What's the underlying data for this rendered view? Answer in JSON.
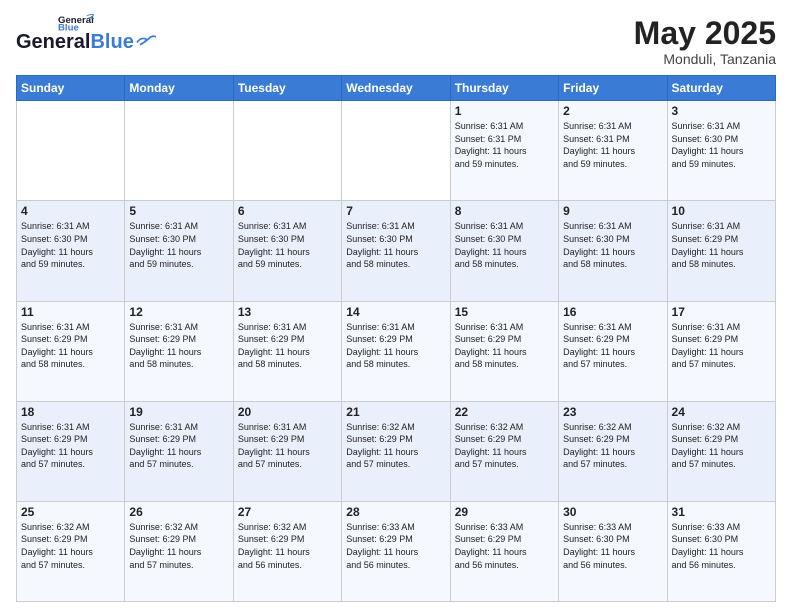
{
  "header": {
    "logo_line1": "General",
    "logo_line2": "Blue",
    "month_year": "May 2025",
    "location": "Monduli, Tanzania"
  },
  "days_of_week": [
    "Sunday",
    "Monday",
    "Tuesday",
    "Wednesday",
    "Thursday",
    "Friday",
    "Saturday"
  ],
  "weeks": [
    [
      {
        "day": "",
        "info": ""
      },
      {
        "day": "",
        "info": ""
      },
      {
        "day": "",
        "info": ""
      },
      {
        "day": "",
        "info": ""
      },
      {
        "day": "1",
        "info": "Sunrise: 6:31 AM\nSunset: 6:31 PM\nDaylight: 11 hours\nand 59 minutes."
      },
      {
        "day": "2",
        "info": "Sunrise: 6:31 AM\nSunset: 6:31 PM\nDaylight: 11 hours\nand 59 minutes."
      },
      {
        "day": "3",
        "info": "Sunrise: 6:31 AM\nSunset: 6:30 PM\nDaylight: 11 hours\nand 59 minutes."
      }
    ],
    [
      {
        "day": "4",
        "info": "Sunrise: 6:31 AM\nSunset: 6:30 PM\nDaylight: 11 hours\nand 59 minutes."
      },
      {
        "day": "5",
        "info": "Sunrise: 6:31 AM\nSunset: 6:30 PM\nDaylight: 11 hours\nand 59 minutes."
      },
      {
        "day": "6",
        "info": "Sunrise: 6:31 AM\nSunset: 6:30 PM\nDaylight: 11 hours\nand 59 minutes."
      },
      {
        "day": "7",
        "info": "Sunrise: 6:31 AM\nSunset: 6:30 PM\nDaylight: 11 hours\nand 58 minutes."
      },
      {
        "day": "8",
        "info": "Sunrise: 6:31 AM\nSunset: 6:30 PM\nDaylight: 11 hours\nand 58 minutes."
      },
      {
        "day": "9",
        "info": "Sunrise: 6:31 AM\nSunset: 6:30 PM\nDaylight: 11 hours\nand 58 minutes."
      },
      {
        "day": "10",
        "info": "Sunrise: 6:31 AM\nSunset: 6:29 PM\nDaylight: 11 hours\nand 58 minutes."
      }
    ],
    [
      {
        "day": "11",
        "info": "Sunrise: 6:31 AM\nSunset: 6:29 PM\nDaylight: 11 hours\nand 58 minutes."
      },
      {
        "day": "12",
        "info": "Sunrise: 6:31 AM\nSunset: 6:29 PM\nDaylight: 11 hours\nand 58 minutes."
      },
      {
        "day": "13",
        "info": "Sunrise: 6:31 AM\nSunset: 6:29 PM\nDaylight: 11 hours\nand 58 minutes."
      },
      {
        "day": "14",
        "info": "Sunrise: 6:31 AM\nSunset: 6:29 PM\nDaylight: 11 hours\nand 58 minutes."
      },
      {
        "day": "15",
        "info": "Sunrise: 6:31 AM\nSunset: 6:29 PM\nDaylight: 11 hours\nand 58 minutes."
      },
      {
        "day": "16",
        "info": "Sunrise: 6:31 AM\nSunset: 6:29 PM\nDaylight: 11 hours\nand 57 minutes."
      },
      {
        "day": "17",
        "info": "Sunrise: 6:31 AM\nSunset: 6:29 PM\nDaylight: 11 hours\nand 57 minutes."
      }
    ],
    [
      {
        "day": "18",
        "info": "Sunrise: 6:31 AM\nSunset: 6:29 PM\nDaylight: 11 hours\nand 57 minutes."
      },
      {
        "day": "19",
        "info": "Sunrise: 6:31 AM\nSunset: 6:29 PM\nDaylight: 11 hours\nand 57 minutes."
      },
      {
        "day": "20",
        "info": "Sunrise: 6:31 AM\nSunset: 6:29 PM\nDaylight: 11 hours\nand 57 minutes."
      },
      {
        "day": "21",
        "info": "Sunrise: 6:32 AM\nSunset: 6:29 PM\nDaylight: 11 hours\nand 57 minutes."
      },
      {
        "day": "22",
        "info": "Sunrise: 6:32 AM\nSunset: 6:29 PM\nDaylight: 11 hours\nand 57 minutes."
      },
      {
        "day": "23",
        "info": "Sunrise: 6:32 AM\nSunset: 6:29 PM\nDaylight: 11 hours\nand 57 minutes."
      },
      {
        "day": "24",
        "info": "Sunrise: 6:32 AM\nSunset: 6:29 PM\nDaylight: 11 hours\nand 57 minutes."
      }
    ],
    [
      {
        "day": "25",
        "info": "Sunrise: 6:32 AM\nSunset: 6:29 PM\nDaylight: 11 hours\nand 57 minutes."
      },
      {
        "day": "26",
        "info": "Sunrise: 6:32 AM\nSunset: 6:29 PM\nDaylight: 11 hours\nand 57 minutes."
      },
      {
        "day": "27",
        "info": "Sunrise: 6:32 AM\nSunset: 6:29 PM\nDaylight: 11 hours\nand 56 minutes."
      },
      {
        "day": "28",
        "info": "Sunrise: 6:33 AM\nSunset: 6:29 PM\nDaylight: 11 hours\nand 56 minutes."
      },
      {
        "day": "29",
        "info": "Sunrise: 6:33 AM\nSunset: 6:29 PM\nDaylight: 11 hours\nand 56 minutes."
      },
      {
        "day": "30",
        "info": "Sunrise: 6:33 AM\nSunset: 6:30 PM\nDaylight: 11 hours\nand 56 minutes."
      },
      {
        "day": "31",
        "info": "Sunrise: 6:33 AM\nSunset: 6:30 PM\nDaylight: 11 hours\nand 56 minutes."
      }
    ]
  ]
}
